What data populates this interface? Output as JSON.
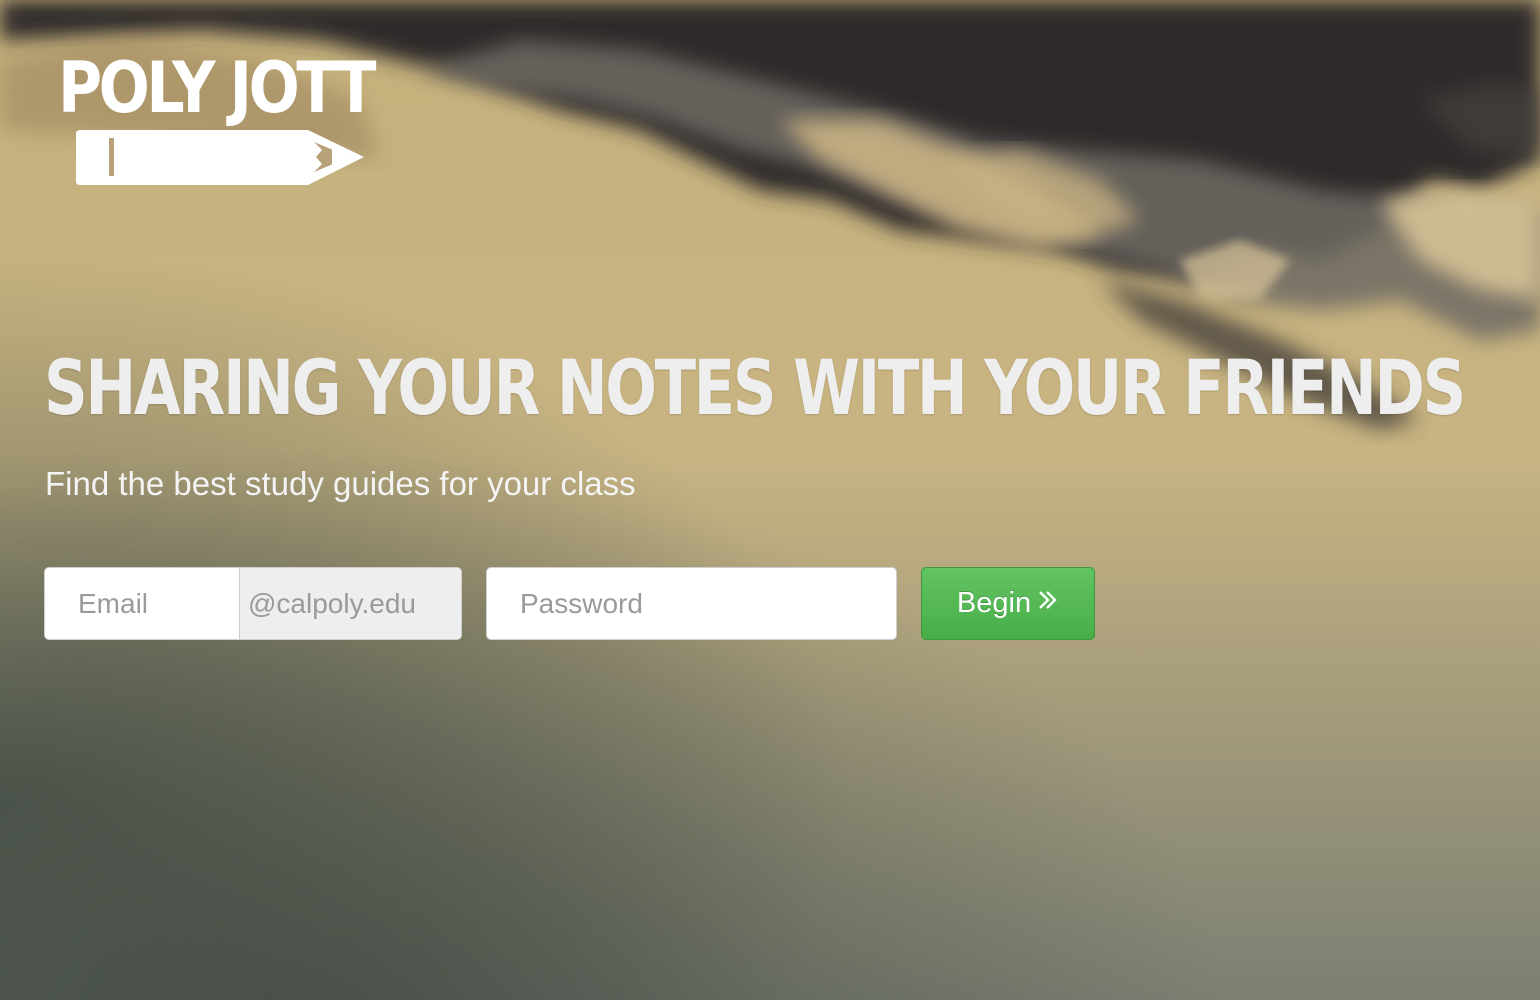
{
  "brand": {
    "name": "POLY JOTT"
  },
  "hero": {
    "headline": "SHARING YOUR NOTES WITH YOUR FRIENDS",
    "subheadline": "Find the best study guides for your class"
  },
  "form": {
    "email_placeholder": "Email",
    "email_suffix": "@calpoly.edu",
    "password_placeholder": "Password",
    "submit_label": "Begin"
  },
  "icons": {
    "logo_mark": "pencil-icon",
    "submit_icon": "double-chevron-right-icon"
  },
  "colors": {
    "button_green": "#5cb85c",
    "headline_text": "#eeeeee",
    "background_tan": "#c9b585"
  }
}
